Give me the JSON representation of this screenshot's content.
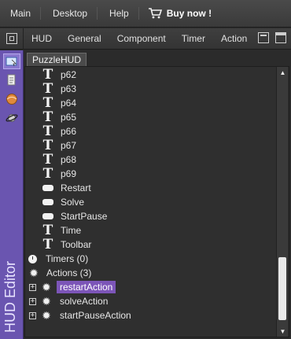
{
  "menubar": {
    "items": [
      "Main",
      "Desktop",
      "Help"
    ],
    "buy_label": "Buy now !"
  },
  "toolbar": {
    "tabs": [
      "HUD",
      "General",
      "Component",
      "Timer",
      "Action"
    ]
  },
  "sidebar": {
    "vertical_title": "HUD Editor",
    "icons": [
      "hud-icon",
      "document-icon",
      "ball-icon",
      "planet-icon"
    ]
  },
  "document_tab": "PuzzleHUD",
  "tree": {
    "rows": [
      {
        "type": "text",
        "label": "p62"
      },
      {
        "type": "text",
        "label": "p63"
      },
      {
        "type": "text",
        "label": "p64"
      },
      {
        "type": "text",
        "label": "p65"
      },
      {
        "type": "text",
        "label": "p66"
      },
      {
        "type": "text",
        "label": "p67"
      },
      {
        "type": "text",
        "label": "p68"
      },
      {
        "type": "text",
        "label": "p69"
      },
      {
        "type": "button",
        "label": "Restart"
      },
      {
        "type": "button",
        "label": "Solve"
      },
      {
        "type": "button",
        "label": "StartPause"
      },
      {
        "type": "text",
        "label": "Time"
      },
      {
        "type": "text",
        "label": "Toolbar"
      }
    ],
    "timers_label": "Timers (0)",
    "actions_label": "Actions (3)",
    "actions": [
      "restartAction",
      "solveAction",
      "startPauseAction"
    ],
    "selected_action": "restartAction"
  },
  "colors": {
    "accent": "#7c55b8",
    "sidebar": "#6a55b0"
  }
}
